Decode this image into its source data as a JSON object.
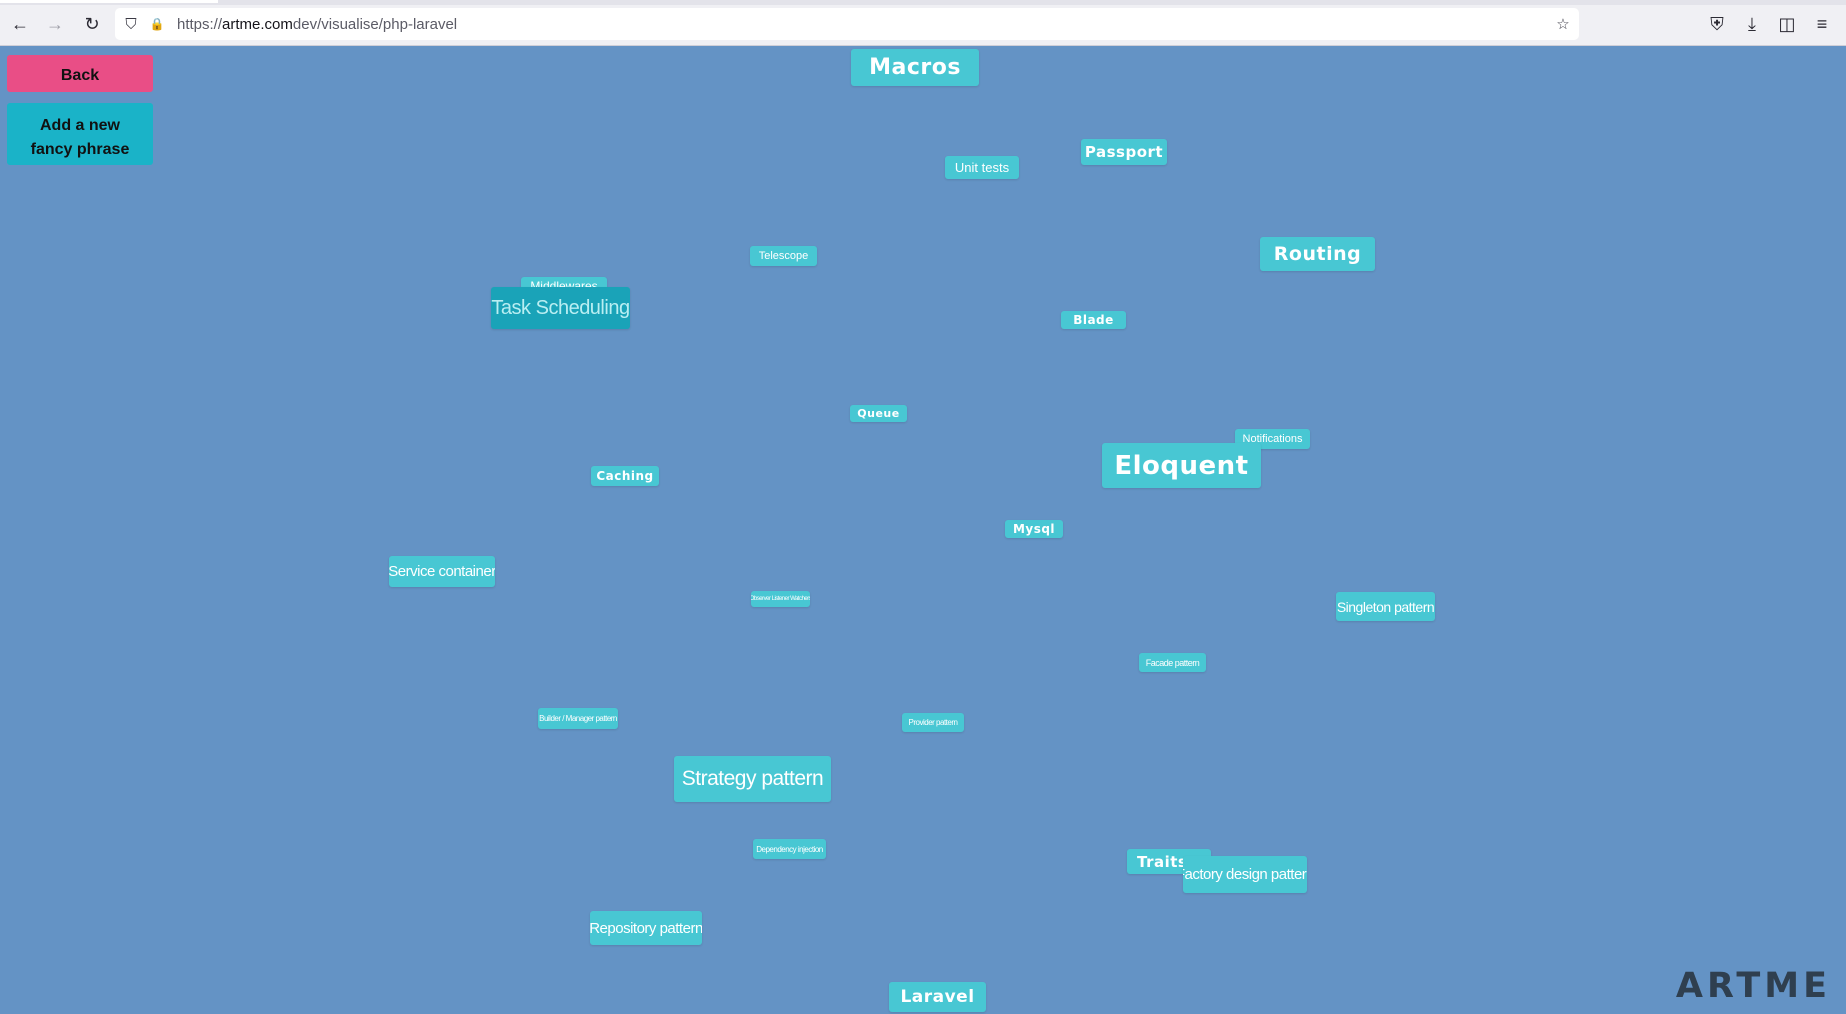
{
  "browser": {
    "url_prefix": "https://",
    "url_host": "artme.com",
    "url_path": "dev/visualise/php-laravel",
    "icons": {
      "back": "←",
      "forward": "→",
      "reload": "↻",
      "shield": "⛉",
      "lock": "🔒",
      "star": "☆",
      "pocket": "⛨",
      "download": "⤓",
      "sidebar": "◫",
      "menu": "≡"
    }
  },
  "controls": {
    "back_label": "Back",
    "add_label": "Add a new fancy phrase"
  },
  "colors": {
    "background": "#6493c5",
    "tag": "#48c7d3",
    "tag_active": "#1aa3b8",
    "back_button": "#e94e86",
    "add_button": "#1ab3c8"
  },
  "tags": [
    "Macros",
    "Passport",
    "Unit tests",
    "Routing",
    "Telescope",
    "Middlewares",
    "Task Scheduling",
    "Blade",
    "Queue",
    "Notifications",
    "Eloquent",
    "Caching",
    "Mysql",
    "Service container",
    "Observer Listener Watchers",
    "Singleton pattern",
    "Facade pattern",
    "Builder / Manager pattern",
    "Provider pattern",
    "Strategy pattern",
    "Dependency injection",
    "Traits",
    "Factory design pattern",
    "Repository pattern",
    "Laravel"
  ],
  "brand": {
    "logo": "ARTME"
  }
}
